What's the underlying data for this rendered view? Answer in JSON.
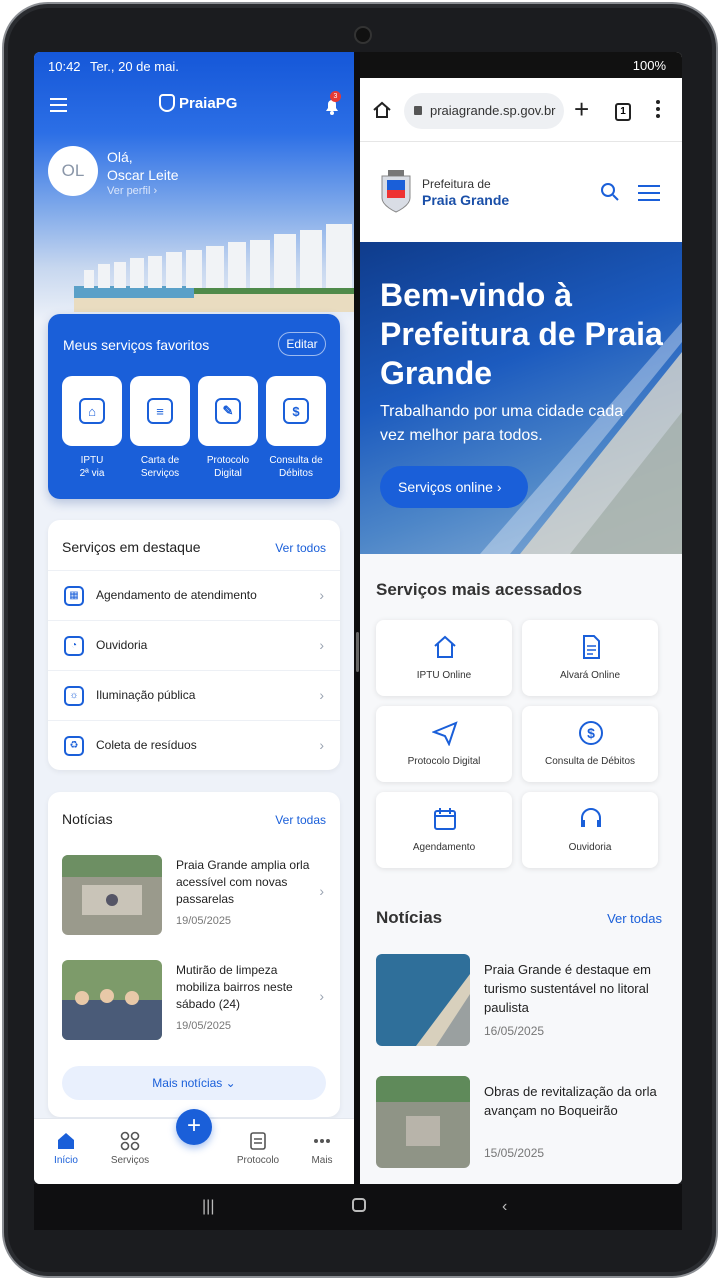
{
  "left_app": {
    "status_time": "10:42",
    "status_date": "Ter., 20 de mai.",
    "app_name": "PraiaPG",
    "notification_count": "3",
    "avatar_initials": "OL",
    "greeting": "Olá,",
    "user_name": "Oscar Leite",
    "profile_link": "Ver perfil ›",
    "favorites": {
      "title": "Meus serviços favoritos",
      "edit_label": "Editar",
      "items": [
        {
          "label_1": "IPTU",
          "label_2": "2ª via",
          "icon": "house-icon"
        },
        {
          "label_1": "Carta de",
          "label_2": "Serviços",
          "icon": "document-icon"
        },
        {
          "label_1": "Protocolo",
          "label_2": "Digital",
          "icon": "edit-icon"
        },
        {
          "label_1": "Consulta de",
          "label_2": "Débitos",
          "icon": "dollar-icon"
        }
      ]
    },
    "featured": {
      "title": "Serviços em destaque",
      "see_all": "Ver todos",
      "items": [
        {
          "label": "Agendamento de atendimento",
          "icon": "calendar-icon"
        },
        {
          "label": "Ouvidoria",
          "icon": "chat-icon"
        },
        {
          "label": "Iluminação pública",
          "icon": "lightbulb-icon"
        },
        {
          "label": "Coleta de resíduos",
          "icon": "recycle-icon"
        }
      ]
    },
    "news": {
      "title": "Notícias",
      "see_all": "Ver todas",
      "items": [
        {
          "title": "Praia Grande amplia orla acessível com novas passarelas",
          "date": "19/05/2025"
        },
        {
          "title": "Mutirão de limpeza mobiliza bairros neste sábado (24)",
          "date": "19/05/2025"
        }
      ],
      "more_label": "Mais notícias ⌄"
    },
    "tabbar": {
      "home": "Início",
      "services": "Serviços",
      "protocol": "Protocolo",
      "more": "Mais",
      "fab": "+"
    }
  },
  "browser": {
    "battery": "100%",
    "url": "praiagrande.sp.gov.br",
    "tab_count": "1",
    "org_line1": "Prefeitura de",
    "org_line2": "Praia Grande",
    "hero_title": "Bem-vindo à Prefeitura de Praia Grande",
    "hero_subtitle": "Trabalhando por uma cidade cada vez melhor para todos.",
    "hero_button": "Serviços online  ›",
    "services_title": "Serviços mais acessados",
    "services": [
      {
        "label": "IPTU Online",
        "icon": "house-icon"
      },
      {
        "label": "Alvará Online",
        "icon": "document-icon"
      },
      {
        "label": "Protocolo Digital",
        "icon": "send-icon"
      },
      {
        "label": "Consulta de Débitos",
        "icon": "dollar-icon"
      },
      {
        "label": "Agendamento",
        "icon": "calendar-icon"
      },
      {
        "label": "Ouvidoria",
        "icon": "headset-icon"
      }
    ],
    "news_title": "Notícias",
    "news_see_all": "Ver todas",
    "news": [
      {
        "title": "Praia Grande é destaque em turismo sustentável no litoral paulista",
        "date": "16/05/2025"
      },
      {
        "title": "Obras de revitalização da orla avançam no Boqueirão",
        "date": "15/05/2025"
      }
    ]
  },
  "colors": {
    "primary": "#1a5fd9",
    "brand_dark": "#1a4fa8"
  }
}
